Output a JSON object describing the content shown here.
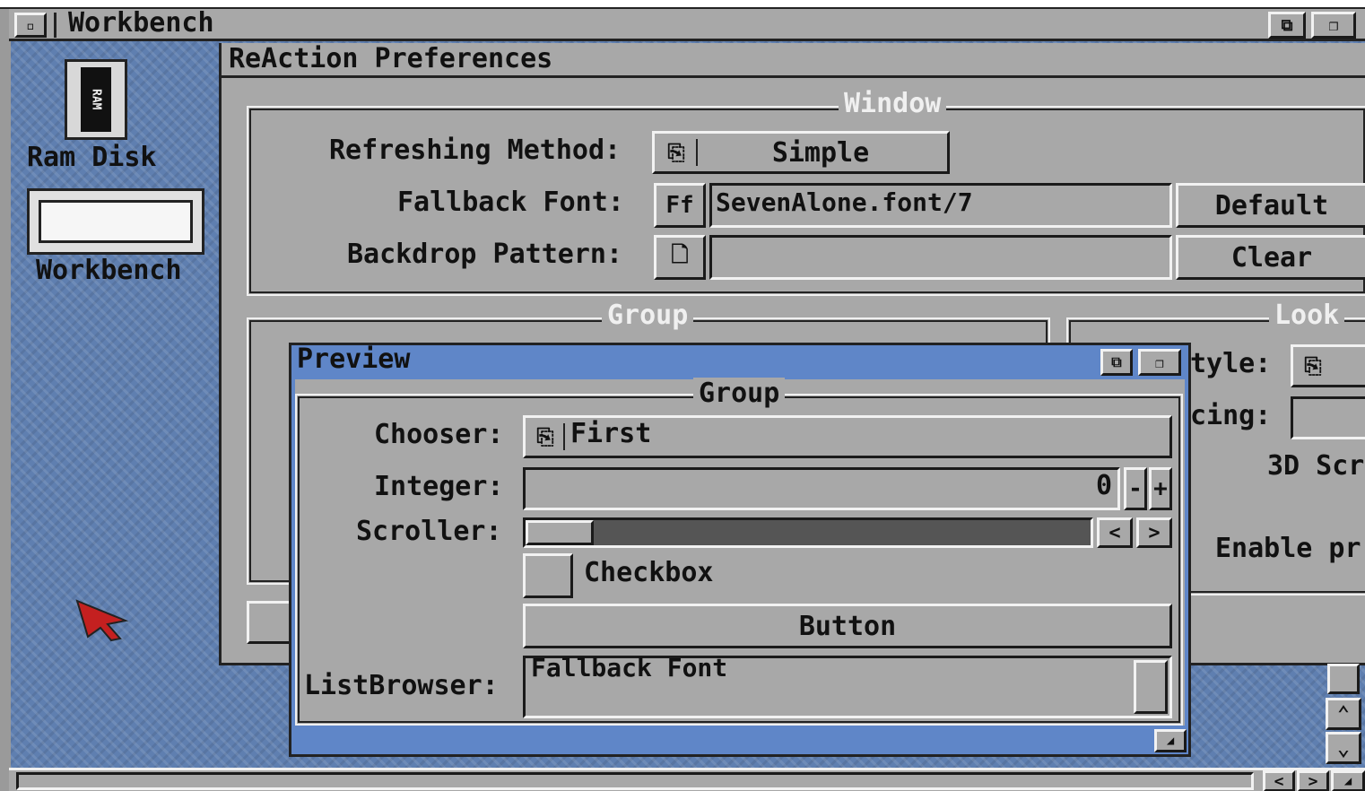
{
  "screen": {
    "title": "Workbench"
  },
  "desktop": {
    "icons": [
      {
        "label": "Ram Disk",
        "glyph": "RAM"
      },
      {
        "label": "Workbench"
      }
    ]
  },
  "prefs": {
    "title": "ReAction Preferences",
    "window_group": {
      "title": "Window",
      "refresh_label": "Refreshing Method:",
      "refresh_value": "Simple",
      "font_label": "Fallback Font:",
      "font_icon": "Ff",
      "font_value": "SevenAlone.font/7",
      "default_button": "Default",
      "backdrop_label": "Backdrop Pattern:",
      "backdrop_value": "",
      "clear_button": "Clear"
    },
    "group_title": "Group",
    "look": {
      "title": "Look",
      "style_label": "tyle:",
      "spacing_label": "cing:",
      "scr_label": "3D Scr",
      "enable_label": "Enable pr"
    }
  },
  "preview": {
    "title": "Preview",
    "group_title": "Group",
    "chooser_label": "Chooser:",
    "chooser_value": "First",
    "integer_label": "Integer:",
    "integer_value": "0",
    "minus": "-",
    "plus": "+",
    "scroller_label": "Scroller:",
    "scroll_left": "<",
    "scroll_right": ">",
    "checkbox_label": "Checkbox",
    "button_label": "Button",
    "listbrowser_label": "ListBrowser:",
    "list_items": [
      "Fallback Font"
    ]
  },
  "bottom": {
    "left": "<",
    "right": ">"
  },
  "colors": {
    "window_title": "#5f86c8",
    "desktop": "#5f7fb0",
    "face": "#a8a8a8"
  }
}
